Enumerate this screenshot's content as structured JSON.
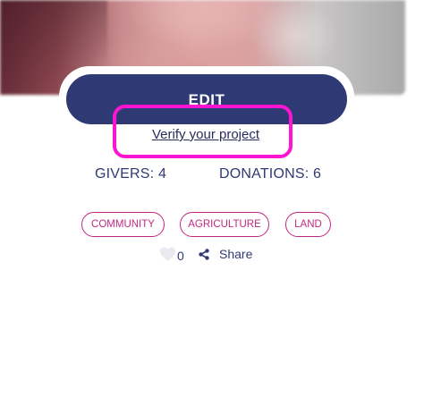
{
  "hero": {
    "image_label": "project photo"
  },
  "actions": {
    "edit_label": "EDIT",
    "verify_label": "Verify your project"
  },
  "stats": {
    "givers": "GIVERS: 4",
    "donations": "DONATIONS: 6"
  },
  "tags": [
    "COMMUNITY",
    "AGRICULTURE",
    "LAND"
  ],
  "social": {
    "likes": "0",
    "share_label": "Share",
    "heart_icon": "heart-icon",
    "share_icon": "share-icon"
  },
  "colors": {
    "primary": "#2f3a74",
    "tag": "#c2287f",
    "highlight": "#ff14d2"
  }
}
